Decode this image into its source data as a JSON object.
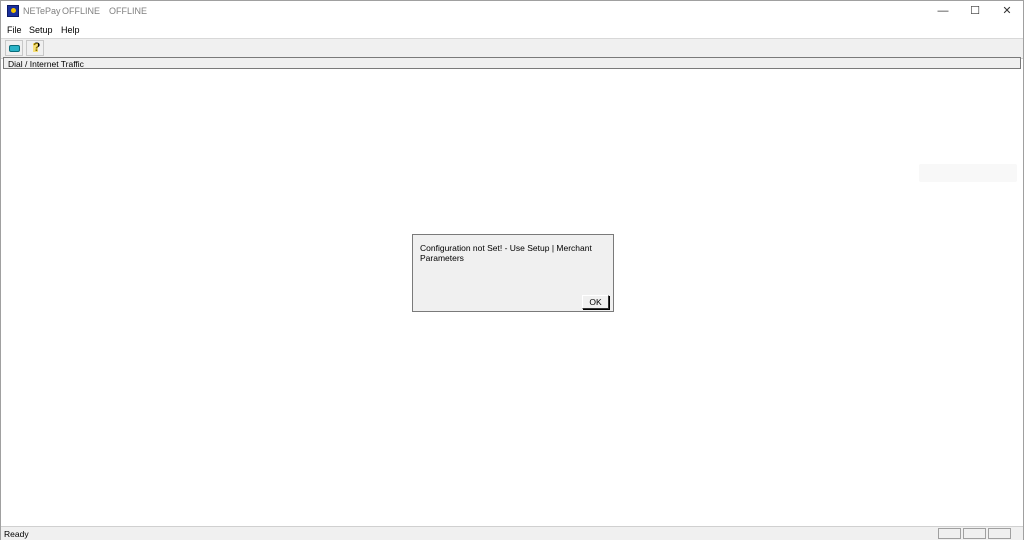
{
  "window": {
    "app_name": "NETePay",
    "status_1": "OFFLINE",
    "status_2": "OFFLINE",
    "controls": {
      "minimize": "—",
      "maximize": "☐",
      "close": "✕"
    }
  },
  "menu": {
    "file": "File",
    "setup": "Setup",
    "help": "Help"
  },
  "toolbar": {
    "buttons": [
      "connect-icon",
      "help-icon"
    ]
  },
  "panel": {
    "header": "Dial / Internet Traffic"
  },
  "dialog": {
    "message": "Configuration not Set! - Use Setup | Merchant Parameters",
    "ok_label": "OK"
  },
  "status": {
    "text": "Ready"
  }
}
